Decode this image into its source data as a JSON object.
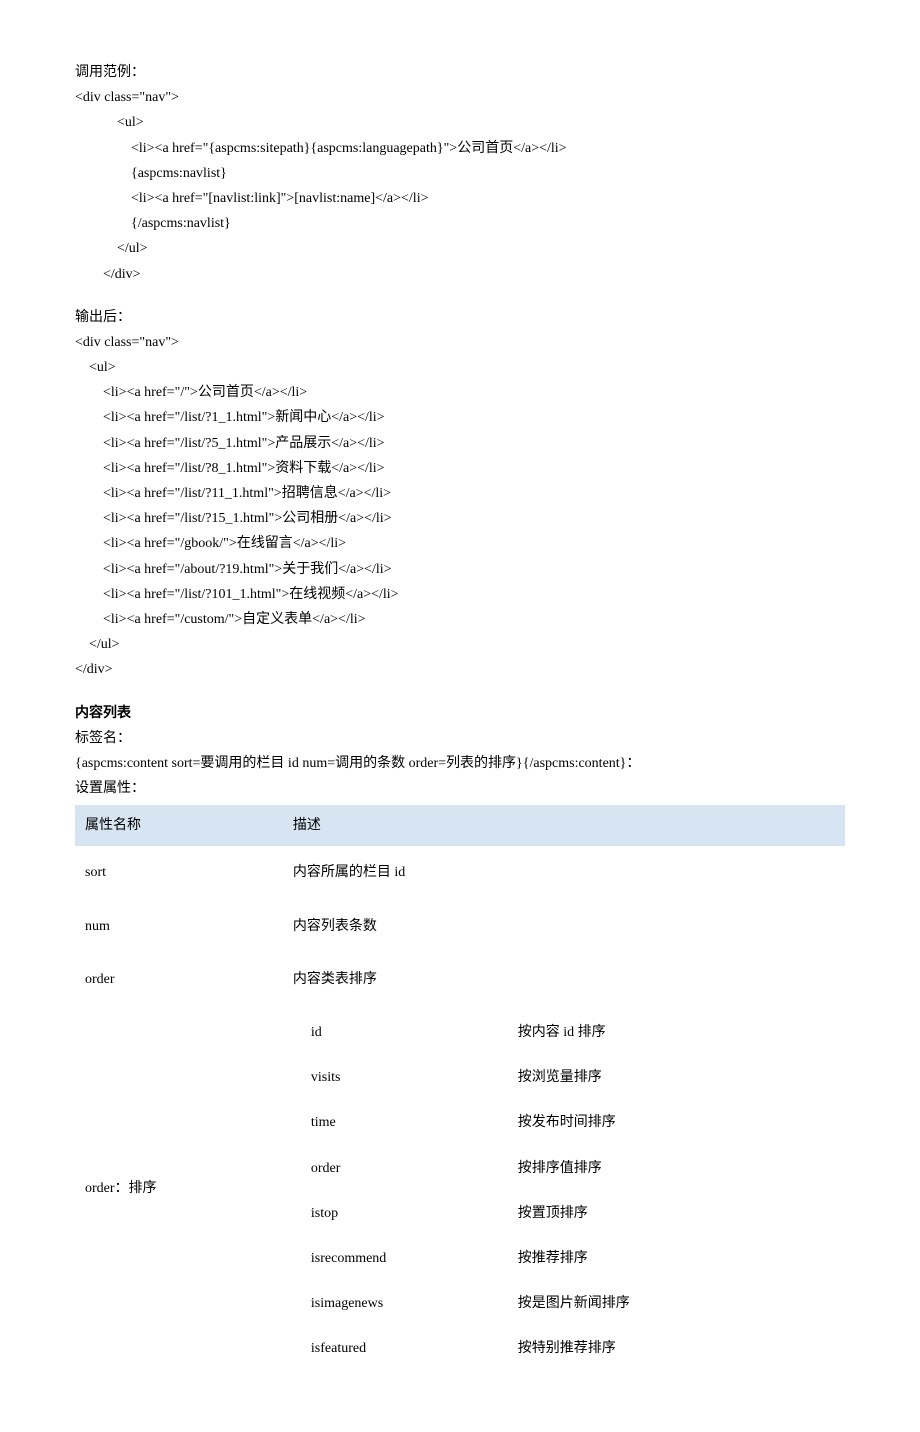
{
  "section1": {
    "title": "调用范例：",
    "lines": [
      "<div class=\"nav\">",
      "            <ul>",
      "                <li><a href=\"{aspcms:sitepath}{aspcms:languagepath}\">公司首页</a></li>",
      "                {aspcms:navlist}",
      "                <li><a href=\"[navlist:link]\">[navlist:name]</a></li>",
      "                {/aspcms:navlist}",
      "            </ul>",
      "        </div>"
    ]
  },
  "section2": {
    "title": "输出后：",
    "lines": [
      "<div class=\"nav\">",
      "    <ul>",
      "        <li><a href=\"/\">公司首页</a></li>",
      "        <li><a href=\"/list/?1_1.html\">新闻中心</a></li>",
      "        <li><a href=\"/list/?5_1.html\">产品展示</a></li>",
      "        <li><a href=\"/list/?8_1.html\">资料下载</a></li>",
      "        <li><a href=\"/list/?11_1.html\">招聘信息</a></li>",
      "        <li><a href=\"/list/?15_1.html\">公司相册</a></li>",
      "        <li><a href=\"/gbook/\">在线留言</a></li>",
      "        <li><a href=\"/about/?19.html\">关于我们</a></li>",
      "        <li><a href=\"/list/?101_1.html\">在线视频</a></li>",
      "        <li><a href=\"/custom/\">自定义表单</a></li>",
      "    </ul>",
      "</div>"
    ]
  },
  "section3": {
    "title": "内容列表",
    "label_name": "标签名：",
    "tag_syntax": "{aspcms:content sort=要调用的栏目 id num=调用的条数  order=列表的排序}{/aspcms:content}：",
    "settings_label": "设置属性：",
    "table": {
      "headers": [
        "属性名称",
        "描述"
      ],
      "rows": [
        {
          "name": "sort",
          "desc": "内容所属的栏目 id"
        },
        {
          "name": "num",
          "desc": "内容列表条数"
        },
        {
          "name": "order",
          "desc": "内容类表排序"
        }
      ],
      "order_row": {
        "label": "order：排序",
        "options": [
          {
            "key": "id",
            "desc": "按内容 id 排序"
          },
          {
            "key": "visits",
            "desc": "按浏览量排序"
          },
          {
            "key": "time",
            "desc": "按发布时间排序"
          },
          {
            "key": "order",
            "desc": "按排序值排序"
          },
          {
            "key": "istop",
            "desc": "按置顶排序"
          },
          {
            "key": "isrecommend",
            "desc": "按推荐排序"
          },
          {
            "key": "isimagenews",
            "desc": "按是图片新闻排序"
          },
          {
            "key": "isfeatured",
            "desc": "按特别推荐排序"
          }
        ]
      }
    }
  }
}
